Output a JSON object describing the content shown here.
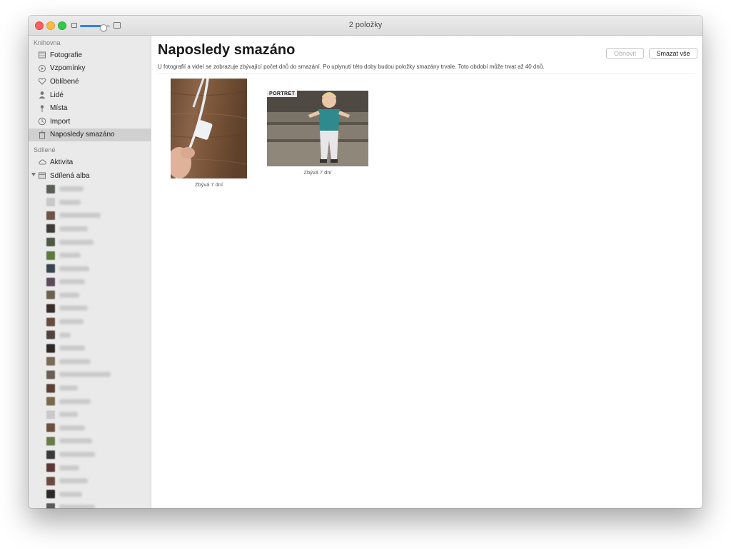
{
  "window": {
    "title": "2 položky"
  },
  "sidebar": {
    "library_heading": "Knihovna",
    "library_items": [
      {
        "label": "Fotografie",
        "icon": "photos-icon"
      },
      {
        "label": "Vzpomínky",
        "icon": "memories-icon"
      },
      {
        "label": "Oblíbené",
        "icon": "heart-icon"
      },
      {
        "label": "Lidé",
        "icon": "person-icon"
      },
      {
        "label": "Místa",
        "icon": "pin-icon"
      },
      {
        "label": "Import",
        "icon": "clock-icon"
      },
      {
        "label": "Naposledy smazáno",
        "icon": "trash-icon",
        "selected": true
      }
    ],
    "shared_heading": "Sdílené",
    "shared_items": [
      {
        "label": "Aktivita",
        "icon": "cloud-icon"
      },
      {
        "label": "Sdílená alba",
        "icon": "shared-albums-icon",
        "expanded": true
      }
    ],
    "albums_count": 25,
    "album_thumb_colors": [
      "#5a5f57",
      "#c9c9c9",
      "#6b5446",
      "#3f3b38",
      "#4d5a44",
      "#5c7a3b",
      "#3a4652",
      "#5d4a5a",
      "#6d6252",
      "#3b2f2b",
      "#6a4a3c",
      "#50443c",
      "#2f2a26",
      "#7a6a58",
      "#6a5f55",
      "#5a4038",
      "#7b6a4a",
      "#c9c9c9",
      "#6a5040",
      "#6a7a4a",
      "#3a3a3a",
      "#5a3838",
      "#6a4a40",
      "#2a2a2a",
      "#5a5a5a"
    ]
  },
  "main": {
    "title": "Naposledy smazáno",
    "refresh_label": "Obnovit",
    "delete_all_label": "Smazat vše",
    "description": "U fotografií a videí se zobrazuje zbývající počet dnů do smazání. Po uplynutí této doby budou položky smazány trvale. Toto období může trvat až 40 dnů.",
    "items": [
      {
        "caption": "Zbývá 7 dní",
        "kind": "photo"
      },
      {
        "caption": "Zbývá 7 dní",
        "kind": "portrait",
        "badge": "PORTRÉT"
      }
    ]
  },
  "colors": {
    "accent": "#2d82f7",
    "selection": "#d0d0d0",
    "sidebar_bg": "#eaeaea"
  }
}
